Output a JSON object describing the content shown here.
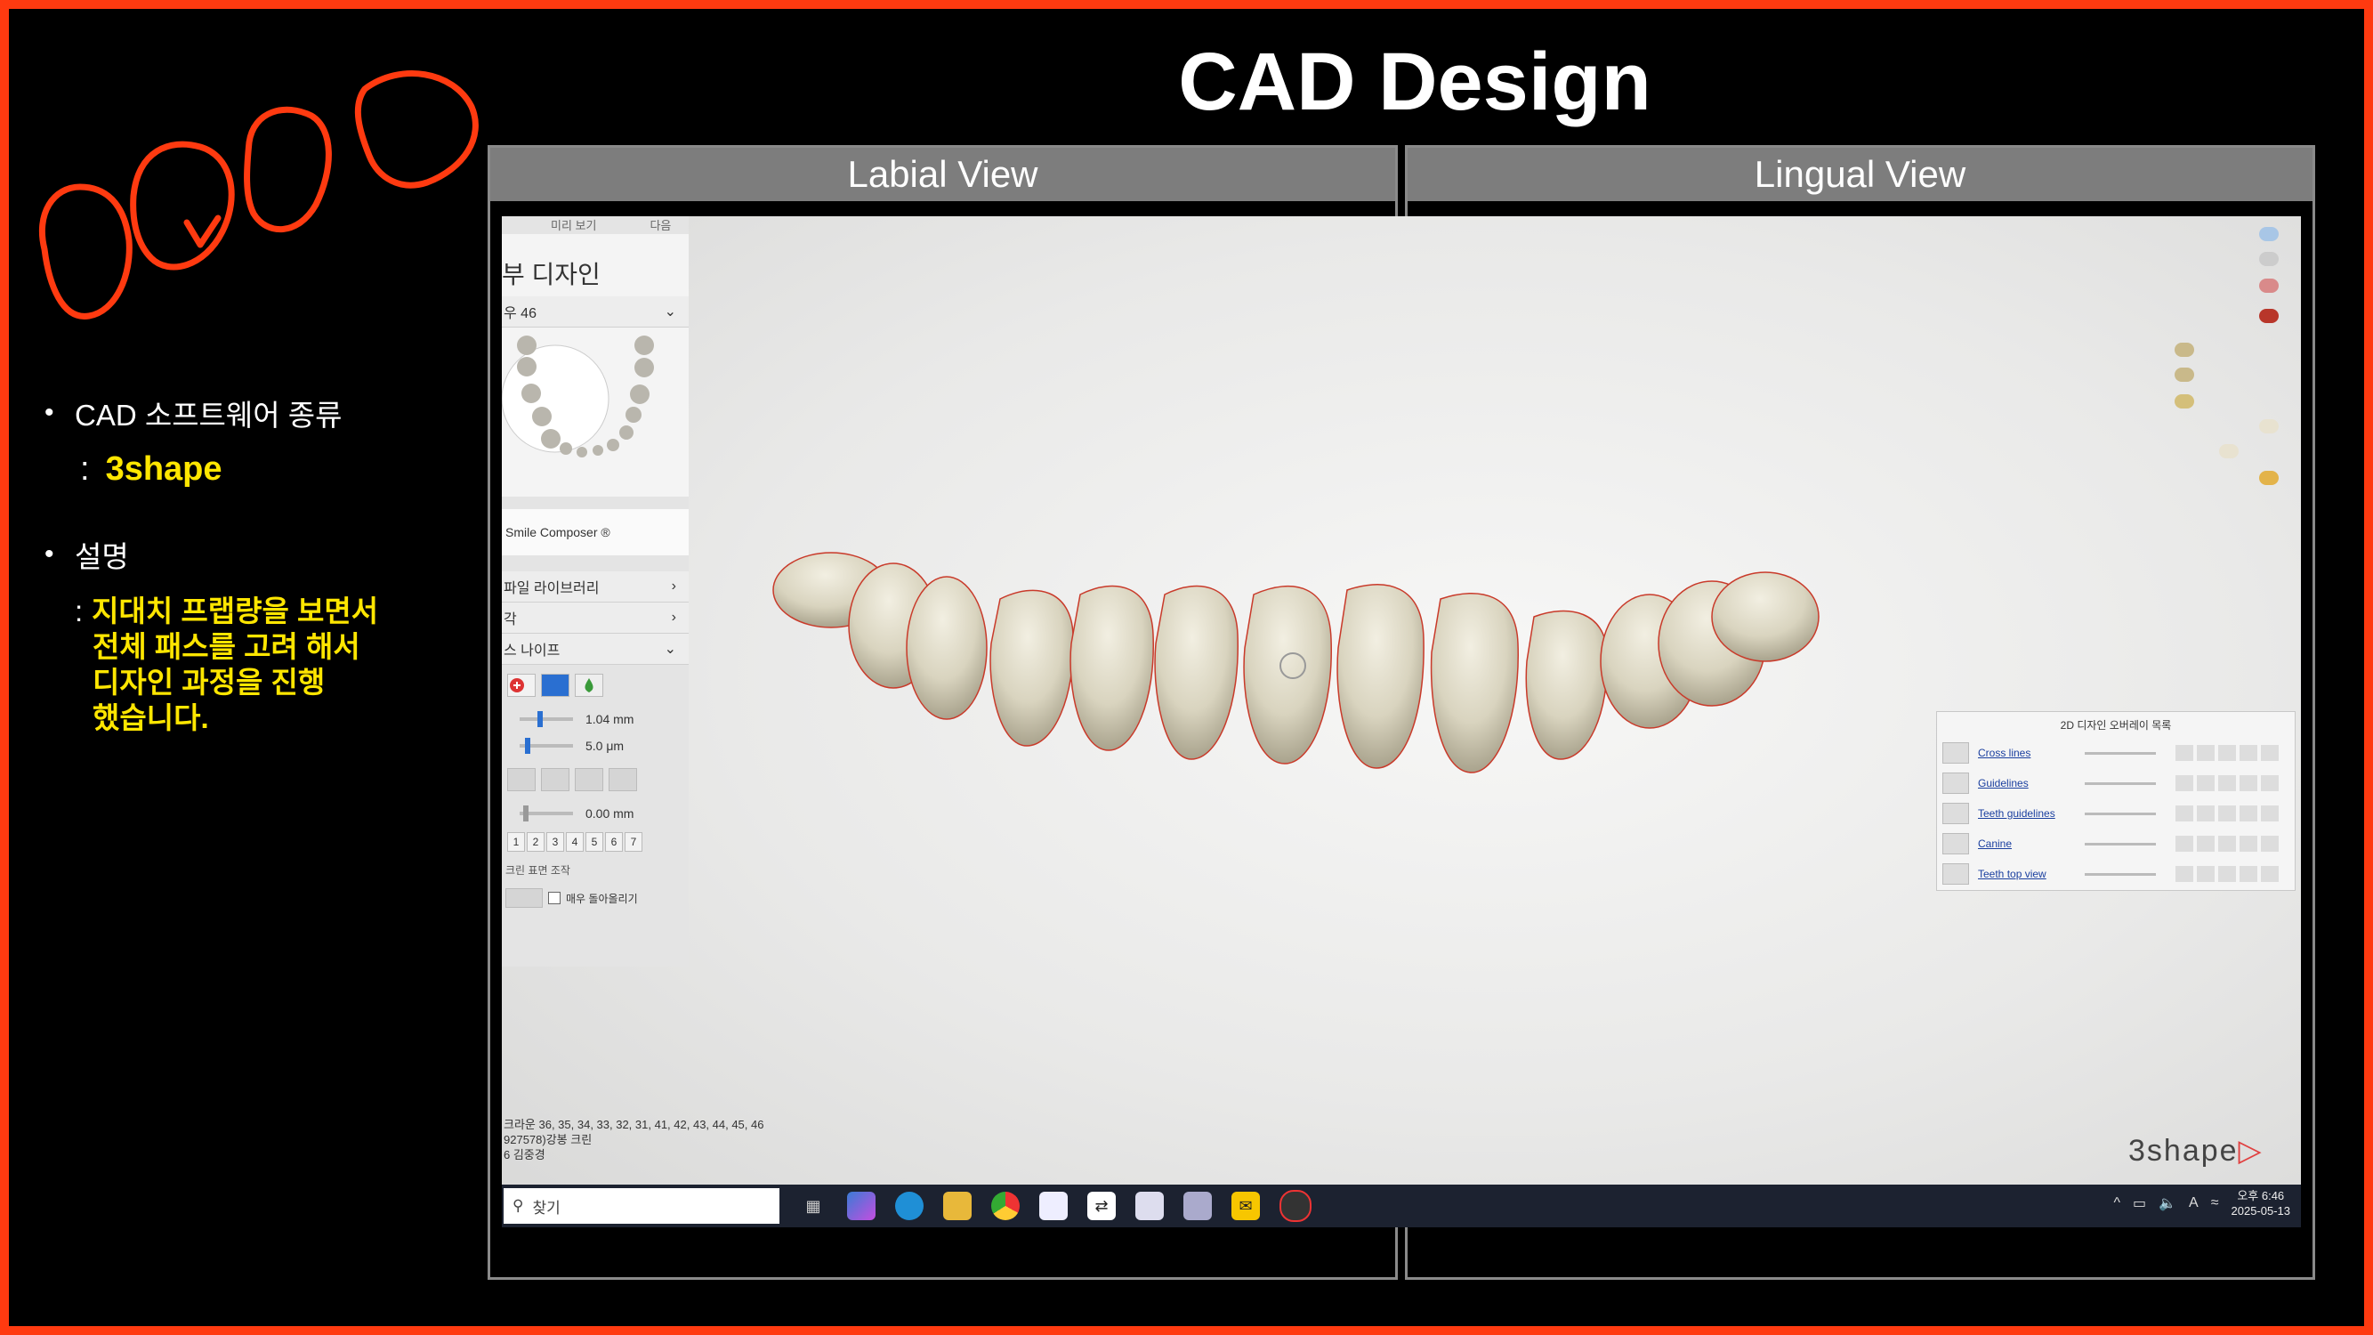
{
  "slide": {
    "title": "CAD Design",
    "accent_color": "#ff3a10",
    "highlight_color": "#ffe600"
  },
  "bullets": {
    "software_label": "CAD 소프트웨어 종류",
    "software_value": "3shape",
    "desc_label": "설명",
    "desc_lines": [
      "지대치 프랩량을 보면서",
      "전체 패스를 고려 해서",
      "디자인 과정을 진행",
      "했습니다."
    ]
  },
  "panels": {
    "left_title": "Labial View",
    "right_title": "Lingual View"
  },
  "cad": {
    "top_tabs": [
      "미리 보기",
      "다음"
    ],
    "design_title": "부 디자인",
    "tooth_select": "우 46",
    "smile_composer": "Smile Composer ®",
    "menu_library": "파일 라이브러리",
    "menu_blank": "각",
    "menu_knife": "스 나이프",
    "slider1_value": "1.04 mm",
    "slider2_value": "5.0 μm",
    "slider3_value": "0.00 mm",
    "numbers": [
      "1",
      "2",
      "3",
      "4",
      "5",
      "6",
      "7"
    ],
    "surface_label": "크린 표면 조작",
    "checkbox_label": "매우 돌아올리기",
    "bottom_info": [
      "크라운 36, 35, 34, 33, 32, 31, 41, 42, 43, 44, 45, 46",
      "927578)강봉 크린",
      "6 김중경"
    ],
    "brand": "3shape",
    "overlay": {
      "title": "2D 디자인 오버레이 목록",
      "rows": [
        "Cross lines",
        "Guidelines",
        "Teeth guidelines",
        "Canine",
        "Teeth top view"
      ]
    }
  },
  "taskbar": {
    "search_placeholder": "찾기",
    "icons": [
      "task-view-icon",
      "copilot-icon",
      "edge-icon",
      "file-explorer-icon",
      "chrome-icon",
      "app-icon",
      "remote-icon",
      "app2-icon",
      "app3-icon",
      "kakaotalk-icon",
      "3shape-icon"
    ],
    "time": "오후 6:46",
    "date": "2025-05-13",
    "ime": "A"
  }
}
